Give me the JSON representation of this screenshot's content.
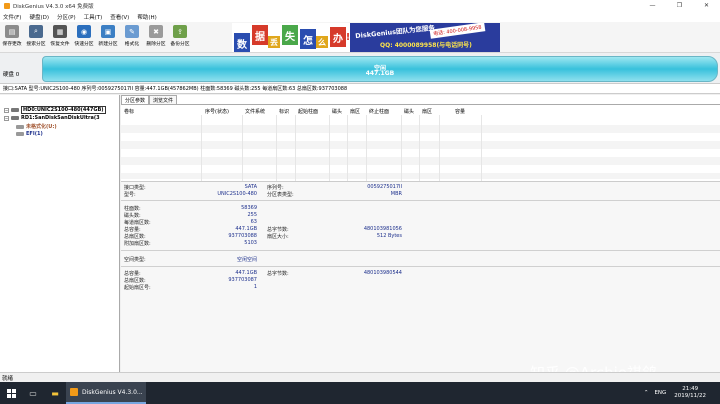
{
  "window": {
    "title": "DiskGenius V4.3.0 x64 免费版",
    "buttons": [
      "—",
      "❐",
      "✕"
    ]
  },
  "menu": [
    "文件(F)",
    "硬盘(D)",
    "分区(P)",
    "工具(T)",
    "查看(V)",
    "帮助(H)"
  ],
  "toolbar": [
    {
      "label": "保存更改",
      "icon": "save-icon",
      "color": "#8c8c8c"
    },
    {
      "label": "搜索分区",
      "icon": "search-icon",
      "color": "#4b6a8f"
    },
    {
      "label": "恢复文件",
      "icon": "recover-icon",
      "color": "#555555"
    },
    {
      "label": "快速分区",
      "icon": "quick-partition-icon",
      "color": "#2c6fbd"
    },
    {
      "label": "新建分区",
      "icon": "new-partition-icon",
      "color": "#3c7fc4"
    },
    {
      "label": "格式化",
      "icon": "format-icon",
      "color": "#6b9bd1"
    },
    {
      "label": "删除分区",
      "icon": "delete-partition-icon",
      "color": "#9b9b9b"
    },
    {
      "label": "备份分区",
      "icon": "backup-icon",
      "color": "#6fa04a"
    }
  ],
  "banner": {
    "chars": [
      "数",
      "据",
      "丢",
      "失",
      "怎",
      "么",
      "办",
      "!"
    ],
    "brand": "DiskGenius团队为您服务",
    "qq": "QQ: 4000089958(与电话同号)",
    "tel": "电话: 400-008-9958"
  },
  "diskbar": {
    "label": "硬盘 0",
    "free_label": "空闲",
    "size": "447.1GB"
  },
  "infobar": "接口:SATA  型号:UNIC2S100-480  序列号:0059275017II  容量:447.1GB(457862MB)  柱面数:58369  磁头数:255  每道扇区数:63  总扇区数:937703088",
  "tree": [
    {
      "text": "HD0:UNIC2S100-480(447GB)",
      "selected": true
    },
    {
      "text": "RD1:SanDiskSanDiskUltra(3",
      "selected": false
    },
    {
      "text": "未格式化(U:)",
      "selected": false
    },
    {
      "text": "EFI(1)",
      "selected": false
    }
  ],
  "tabs": [
    "分区参数",
    "浏览文件"
  ],
  "partition_headers": [
    "卷标",
    "序号(状态)",
    "文件系统",
    "标识",
    "起始柱面",
    "磁头",
    "扇区",
    "终止柱面",
    "磁头",
    "扇区",
    "容量"
  ],
  "details": {
    "interface_type_label": "接口类型:",
    "interface_type": "SATA",
    "model_label": "型号:",
    "model": "UNIC2S100-480",
    "serial_label": "序列号:",
    "serial": "0059275017II",
    "partition_style_label": "分区表类型:",
    "partition_style": "MBR",
    "cylinders_label": "柱面数:",
    "cylinders": "58369",
    "heads_label": "磁头数:",
    "heads": "255",
    "spt_label": "每道扇区数:",
    "spt": "63",
    "capacity_label": "总容量:",
    "capacity": "447.1GB",
    "total_bytes_label": "总字节数:",
    "total_bytes": "480103981056",
    "total_sectors_label": "总扇区数:",
    "total_sectors": "937703088",
    "sector_size_label": "扇区大小:",
    "sector_size": "512 Bytes",
    "extra_sectors_label": "附加扇区数:",
    "extra_sectors": "5103",
    "space_type_label": "空间类型:",
    "space_type": "空闲空间",
    "free_capacity_label": "总容量:",
    "free_capacity": "447.1GB",
    "free_bytes_label": "总字节数:",
    "free_bytes": "480103980544",
    "free_sectors_label": "总扇区数:",
    "free_sectors": "937703087",
    "start_sector_label": "起始扇区号:",
    "start_sector": "1"
  },
  "watermark": "知乎 @Archie祺鸽",
  "status": "就绪",
  "taskbar": {
    "app": "DiskGenius V4.3.0...",
    "ime": "ENG",
    "time": "21:49",
    "date": "2019/11/22"
  }
}
